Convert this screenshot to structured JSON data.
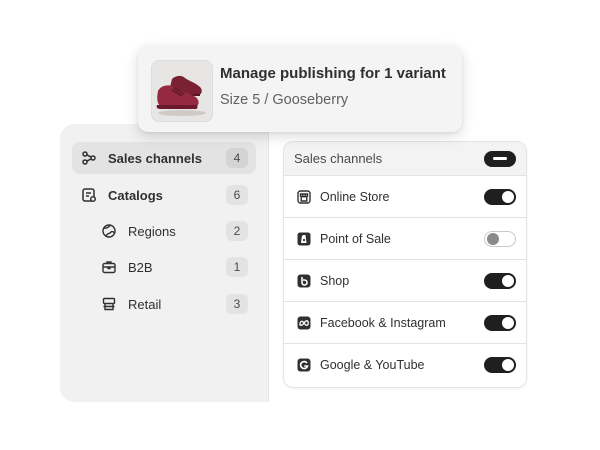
{
  "product": {
    "title": "Manage publishing for 1 variant",
    "variant": "Size 5 / Gooseberry",
    "image": "shoe-thumbnail"
  },
  "sidebar": {
    "items": [
      {
        "label": "Sales channels",
        "count": "4",
        "icon": "sales-channels-icon",
        "active": true
      },
      {
        "label": "Catalogs",
        "count": "6",
        "icon": "catalogs-icon"
      },
      {
        "label": "Regions",
        "count": "2",
        "icon": "globe-icon"
      },
      {
        "label": "B2B",
        "count": "1",
        "icon": "briefcase-icon"
      },
      {
        "label": "Retail",
        "count": "3",
        "icon": "retail-icon"
      }
    ]
  },
  "channels": {
    "header": "Sales channels",
    "header_state": "indeterminate",
    "rows": [
      {
        "label": "Online Store",
        "icon": "online-store-icon",
        "enabled": true
      },
      {
        "label": "Point of Sale",
        "icon": "point-of-sale-icon",
        "enabled": false
      },
      {
        "label": "Shop",
        "icon": "shop-icon",
        "enabled": true
      },
      {
        "label": "Facebook & Instagram",
        "icon": "meta-icon",
        "enabled": true
      },
      {
        "label": "Google & YouTube",
        "icon": "google-icon",
        "enabled": true
      }
    ]
  },
  "colors": {
    "toggle_on": "#1f1f1f",
    "panel_bg": "#f1f1f1",
    "active_item_bg": "#e3e3e3",
    "shoe": "#8e2a3e"
  }
}
